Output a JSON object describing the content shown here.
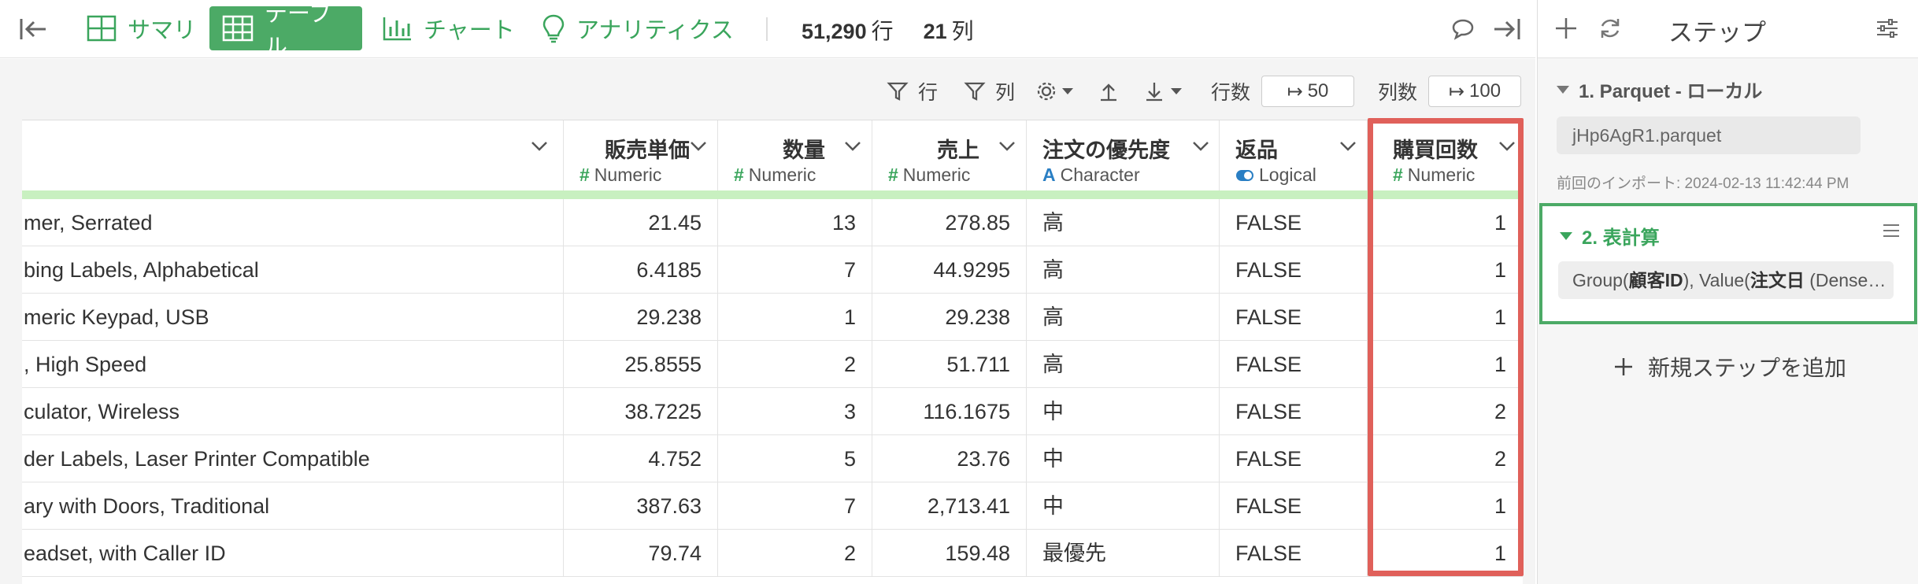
{
  "toolbar": {
    "tabs": [
      {
        "label": "サマリ",
        "icon": "summary-grid-icon",
        "active": false
      },
      {
        "label": "テーブル",
        "icon": "table-icon",
        "active": true
      },
      {
        "label": "チャート",
        "icon": "bar-chart-icon",
        "active": false
      },
      {
        "label": "アナリティクス",
        "icon": "lightbulb-icon",
        "active": false
      }
    ],
    "row_count": "51,290",
    "row_unit": "行",
    "col_count": "21",
    "col_unit": "列"
  },
  "subtoolbar": {
    "filter_rows_label": "行",
    "filter_cols_label": "列",
    "rows_label": "行数",
    "rows_value": "50",
    "cols_label": "列数",
    "cols_value": "100"
  },
  "table": {
    "columns": [
      {
        "name": "",
        "type": "",
        "type_glyph": ""
      },
      {
        "name": "販売単価",
        "type": "Numeric",
        "type_glyph": "#"
      },
      {
        "name": "数量",
        "type": "Numeric",
        "type_glyph": "#"
      },
      {
        "name": "売上",
        "type": "Numeric",
        "type_glyph": "#"
      },
      {
        "name": "注文の優先度",
        "type": "Character",
        "type_glyph": "A"
      },
      {
        "name": "返品",
        "type": "Logical",
        "type_glyph": "toggle"
      },
      {
        "name": "購買回数",
        "type": "Numeric",
        "type_glyph": "#"
      }
    ],
    "rows": [
      [
        "mer, Serrated",
        "21.45",
        "13",
        "278.85",
        "高",
        "FALSE",
        "1"
      ],
      [
        "bing Labels, Alphabetical",
        "6.4185",
        "7",
        "44.9295",
        "高",
        "FALSE",
        "1"
      ],
      [
        "meric Keypad, USB",
        "29.238",
        "1",
        "29.238",
        "高",
        "FALSE",
        "1"
      ],
      [
        ", High Speed",
        "25.8555",
        "2",
        "51.711",
        "高",
        "FALSE",
        "1"
      ],
      [
        "culator, Wireless",
        "38.7225",
        "3",
        "116.1675",
        "中",
        "FALSE",
        "2"
      ],
      [
        "der Labels, Laser Printer Compatible",
        "4.752",
        "5",
        "23.76",
        "中",
        "FALSE",
        "2"
      ],
      [
        "ary with Doors, Traditional",
        "387.63",
        "7",
        "2,713.41",
        "中",
        "FALSE",
        "1"
      ],
      [
        "eadset, with Caller ID",
        "79.74",
        "2",
        "159.48",
        "最優先",
        "FALSE",
        "1"
      ]
    ]
  },
  "panel": {
    "title": "ステップ",
    "step1": {
      "label": "1. Parquet - ローカル",
      "file": "jHp6AgR1.parquet",
      "meta": "前回のインポート: 2024-02-13 11:42:44 PM"
    },
    "step2": {
      "label": "2. 表計算",
      "formula_prefix": "Group(",
      "formula_b1": "顧客ID",
      "formula_mid": "), Value(",
      "formula_b2": "注文日",
      "formula_suffix": " (Dense…"
    },
    "add_step": "新規ステップを追加"
  },
  "colors": {
    "accent": "#4caa66",
    "highlight": "#e0605a",
    "type_bar": "#c8f0c0"
  }
}
